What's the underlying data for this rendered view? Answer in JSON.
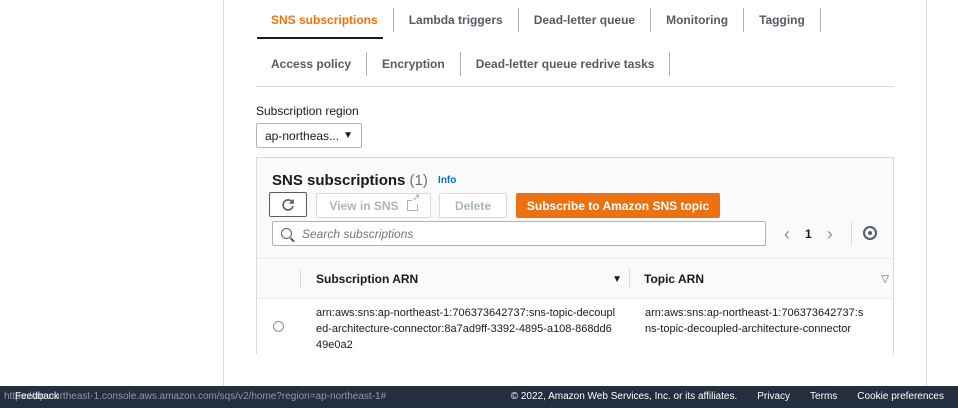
{
  "tabs_row1": [
    "SNS subscriptions",
    "Lambda triggers",
    "Dead-letter queue",
    "Monitoring",
    "Tagging"
  ],
  "tabs_row2": [
    "Access policy",
    "Encryption",
    "Dead-letter queue redrive tasks"
  ],
  "region": {
    "label": "Subscription region",
    "value": "ap-northeas..."
  },
  "card": {
    "title": "SNS subscriptions",
    "count": "(1)",
    "info": "Info",
    "buttons": {
      "view": "View in SNS",
      "delete": "Delete",
      "subscribe": "Subscribe to Amazon SNS topic"
    },
    "search_placeholder": "Search subscriptions",
    "page": "1",
    "columns": {
      "arn": "Subscription ARN",
      "topic": "Topic ARN"
    },
    "rows": [
      {
        "subscription_arn": "arn:aws:sns:ap-northeast-1:706373642737:sns-topic-decoupled-architecture-connector:8a7ad9ff-3392-4895-a108-868dd649e0a2",
        "topic_arn": "arn:aws:sns:ap-northeast-1:706373642737:sns-topic-decoupled-architecture-connector"
      }
    ]
  },
  "footer": {
    "url": "https://ap-northeast-1.console.aws.amazon.com/sqs/v2/home?region=ap-northeast-1#",
    "feedback": "Feedback",
    "copyright": "© 2022, Amazon Web Services, Inc. or its affiliates.",
    "privacy": "Privacy",
    "terms": "Terms",
    "cookies": "Cookie preferences"
  }
}
